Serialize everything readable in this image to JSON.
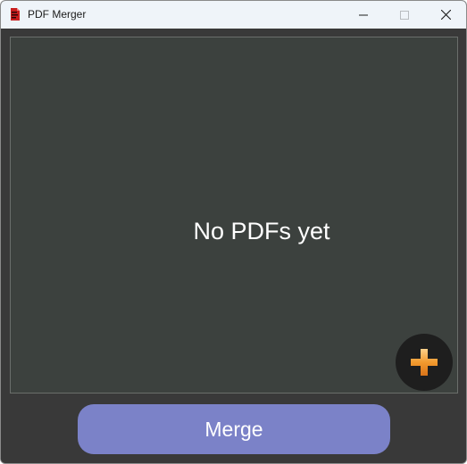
{
  "window": {
    "title": "PDF Merger"
  },
  "title_buttons": {
    "minimize_icon": "minimize-icon",
    "maximize_icon": "maximize-icon",
    "close_icon": "close-icon"
  },
  "drop_area": {
    "empty_message": "No PDFs yet"
  },
  "add_button": {
    "icon": "plus-icon"
  },
  "merge_button": {
    "label": "Merge"
  },
  "colors": {
    "titlebar_bg": "#eff4f9",
    "client_bg": "#393939",
    "drop_area_bg": "#3c413e",
    "add_button_bg": "#1e1e1e",
    "plus_accent": "#f29a2e",
    "merge_button_bg": "#7b82c8"
  }
}
